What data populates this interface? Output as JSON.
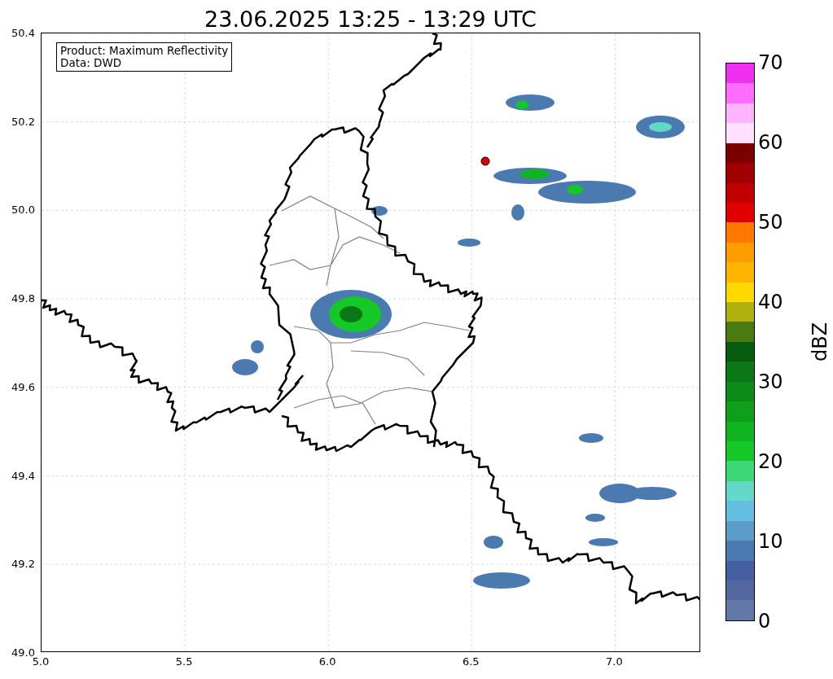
{
  "title": "23.06.2025 13:25 - 13:29 UTC",
  "annotation": [
    "Product: Maximum Reflectivity",
    "Data: DWD"
  ],
  "x_ticks": [
    "5.0",
    "5.5",
    "6.0",
    "6.5",
    "7.0"
  ],
  "y_ticks": [
    "50.4",
    "50.2",
    "50.0",
    "49.8",
    "49.6",
    "49.4",
    "49.2",
    "49.0"
  ],
  "colorbar": {
    "label": "dBZ",
    "ticks": [
      "70",
      "60",
      "50",
      "40",
      "30",
      "20",
      "10",
      "0"
    ],
    "segments": [
      {
        "color": "#f030f0"
      },
      {
        "color": "#ff6cff"
      },
      {
        "color": "#ffb4ff"
      },
      {
        "color": "#ffe0ff"
      },
      {
        "color": "#7a0000"
      },
      {
        "color": "#a00000"
      },
      {
        "color": "#c00000"
      },
      {
        "color": "#e00000"
      },
      {
        "color": "#ff7800"
      },
      {
        "color": "#ff9c00"
      },
      {
        "color": "#ffb400"
      },
      {
        "color": "#ffd800"
      },
      {
        "color": "#b0b010"
      },
      {
        "color": "#4a7a10"
      },
      {
        "color": "#085c10"
      },
      {
        "color": "#0a7814"
      },
      {
        "color": "#0c8c16"
      },
      {
        "color": "#0ea01a"
      },
      {
        "color": "#10b420"
      },
      {
        "color": "#14c828"
      },
      {
        "color": "#3cd878"
      },
      {
        "color": "#64d8c8"
      },
      {
        "color": "#64bee0"
      },
      {
        "color": "#5a9ec8"
      },
      {
        "color": "#4a7ab0"
      },
      {
        "color": "#4560a0"
      },
      {
        "color": "#5468a0"
      },
      {
        "color": "#6478a8"
      }
    ]
  }
}
